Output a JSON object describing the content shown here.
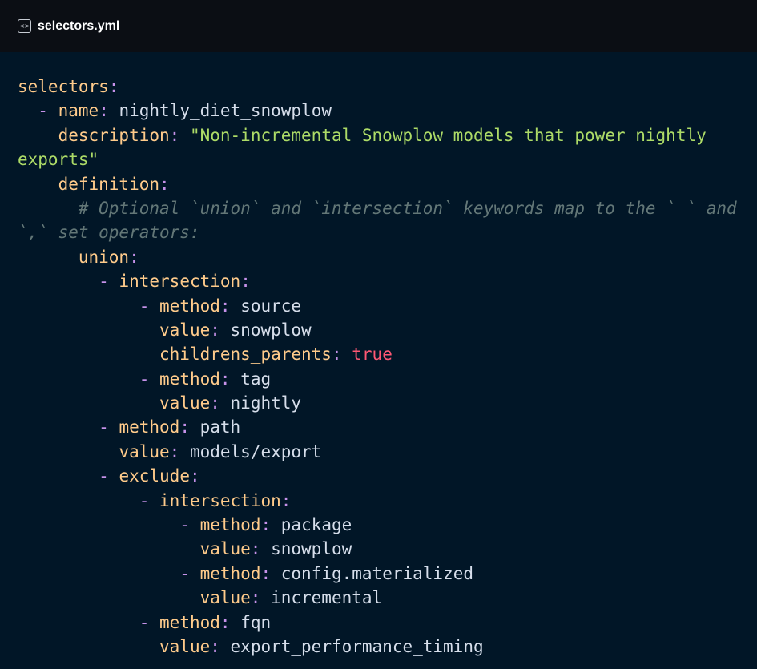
{
  "header": {
    "icon": "code-file-icon",
    "filename": "selectors.yml"
  },
  "colors": {
    "header_bg": "#0b0e14",
    "code_bg": "#011627",
    "key": "#ffcb8b",
    "dash": "#c792ea",
    "string": "#addb67",
    "boolean": "#ff5874",
    "value": "#d6deeb",
    "comment": "#637777"
  },
  "code": {
    "lines": [
      [
        {
          "t": "selectors",
          "c": "key"
        },
        {
          "t": ":",
          "c": "punct"
        }
      ],
      [
        {
          "t": "  ",
          "c": "val"
        },
        {
          "t": "-",
          "c": "dash"
        },
        {
          "t": " ",
          "c": "val"
        },
        {
          "t": "name",
          "c": "key"
        },
        {
          "t": ":",
          "c": "punct"
        },
        {
          "t": " nightly_diet_snowplow",
          "c": "val"
        }
      ],
      [
        {
          "t": "    ",
          "c": "val"
        },
        {
          "t": "description",
          "c": "key"
        },
        {
          "t": ":",
          "c": "punct"
        },
        {
          "t": " \"Non-incremental Snowplow models that power nightly",
          "c": "str"
        }
      ],
      [
        {
          "t": "exports\"",
          "c": "str"
        }
      ],
      [
        {
          "t": "    ",
          "c": "val"
        },
        {
          "t": "definition",
          "c": "key"
        },
        {
          "t": ":",
          "c": "punct"
        }
      ],
      [
        {
          "t": "      # Optional `union` and `intersection` keywords map to the ` ` and",
          "c": "comment"
        }
      ],
      [
        {
          "t": "`,` set operators:",
          "c": "comment"
        }
      ],
      [
        {
          "t": "      ",
          "c": "val"
        },
        {
          "t": "union",
          "c": "key"
        },
        {
          "t": ":",
          "c": "punct"
        }
      ],
      [
        {
          "t": "        ",
          "c": "val"
        },
        {
          "t": "-",
          "c": "dash"
        },
        {
          "t": " ",
          "c": "val"
        },
        {
          "t": "intersection",
          "c": "key"
        },
        {
          "t": ":",
          "c": "punct"
        }
      ],
      [
        {
          "t": "            ",
          "c": "val"
        },
        {
          "t": "-",
          "c": "dash"
        },
        {
          "t": " ",
          "c": "val"
        },
        {
          "t": "method",
          "c": "key"
        },
        {
          "t": ":",
          "c": "punct"
        },
        {
          "t": " source",
          "c": "val"
        }
      ],
      [
        {
          "t": "              ",
          "c": "val"
        },
        {
          "t": "value",
          "c": "key"
        },
        {
          "t": ":",
          "c": "punct"
        },
        {
          "t": " snowplow",
          "c": "val"
        }
      ],
      [
        {
          "t": "              ",
          "c": "val"
        },
        {
          "t": "childrens_parents",
          "c": "key"
        },
        {
          "t": ":",
          "c": "punct"
        },
        {
          "t": " ",
          "c": "val"
        },
        {
          "t": "true",
          "c": "bool"
        }
      ],
      [
        {
          "t": "            ",
          "c": "val"
        },
        {
          "t": "-",
          "c": "dash"
        },
        {
          "t": " ",
          "c": "val"
        },
        {
          "t": "method",
          "c": "key"
        },
        {
          "t": ":",
          "c": "punct"
        },
        {
          "t": " tag",
          "c": "val"
        }
      ],
      [
        {
          "t": "              ",
          "c": "val"
        },
        {
          "t": "value",
          "c": "key"
        },
        {
          "t": ":",
          "c": "punct"
        },
        {
          "t": " nightly",
          "c": "val"
        }
      ],
      [
        {
          "t": "        ",
          "c": "val"
        },
        {
          "t": "-",
          "c": "dash"
        },
        {
          "t": " ",
          "c": "val"
        },
        {
          "t": "method",
          "c": "key"
        },
        {
          "t": ":",
          "c": "punct"
        },
        {
          "t": " path",
          "c": "val"
        }
      ],
      [
        {
          "t": "          ",
          "c": "val"
        },
        {
          "t": "value",
          "c": "key"
        },
        {
          "t": ":",
          "c": "punct"
        },
        {
          "t": " models/export",
          "c": "val"
        }
      ],
      [
        {
          "t": "        ",
          "c": "val"
        },
        {
          "t": "-",
          "c": "dash"
        },
        {
          "t": " ",
          "c": "val"
        },
        {
          "t": "exclude",
          "c": "key"
        },
        {
          "t": ":",
          "c": "punct"
        }
      ],
      [
        {
          "t": "            ",
          "c": "val"
        },
        {
          "t": "-",
          "c": "dash"
        },
        {
          "t": " ",
          "c": "val"
        },
        {
          "t": "intersection",
          "c": "key"
        },
        {
          "t": ":",
          "c": "punct"
        }
      ],
      [
        {
          "t": "                ",
          "c": "val"
        },
        {
          "t": "-",
          "c": "dash"
        },
        {
          "t": " ",
          "c": "val"
        },
        {
          "t": "method",
          "c": "key"
        },
        {
          "t": ":",
          "c": "punct"
        },
        {
          "t": " package",
          "c": "val"
        }
      ],
      [
        {
          "t": "                  ",
          "c": "val"
        },
        {
          "t": "value",
          "c": "key"
        },
        {
          "t": ":",
          "c": "punct"
        },
        {
          "t": " snowplow",
          "c": "val"
        }
      ],
      [
        {
          "t": "                ",
          "c": "val"
        },
        {
          "t": "-",
          "c": "dash"
        },
        {
          "t": " ",
          "c": "val"
        },
        {
          "t": "method",
          "c": "key"
        },
        {
          "t": ":",
          "c": "punct"
        },
        {
          "t": " config.materialized",
          "c": "val"
        }
      ],
      [
        {
          "t": "                  ",
          "c": "val"
        },
        {
          "t": "value",
          "c": "key"
        },
        {
          "t": ":",
          "c": "punct"
        },
        {
          "t": " incremental",
          "c": "val"
        }
      ],
      [
        {
          "t": "            ",
          "c": "val"
        },
        {
          "t": "-",
          "c": "dash"
        },
        {
          "t": " ",
          "c": "val"
        },
        {
          "t": "method",
          "c": "key"
        },
        {
          "t": ":",
          "c": "punct"
        },
        {
          "t": " fqn",
          "c": "val"
        }
      ],
      [
        {
          "t": "              ",
          "c": "val"
        },
        {
          "t": "value",
          "c": "key"
        },
        {
          "t": ":",
          "c": "punct"
        },
        {
          "t": " export_performance_timing",
          "c": "val"
        }
      ]
    ]
  }
}
